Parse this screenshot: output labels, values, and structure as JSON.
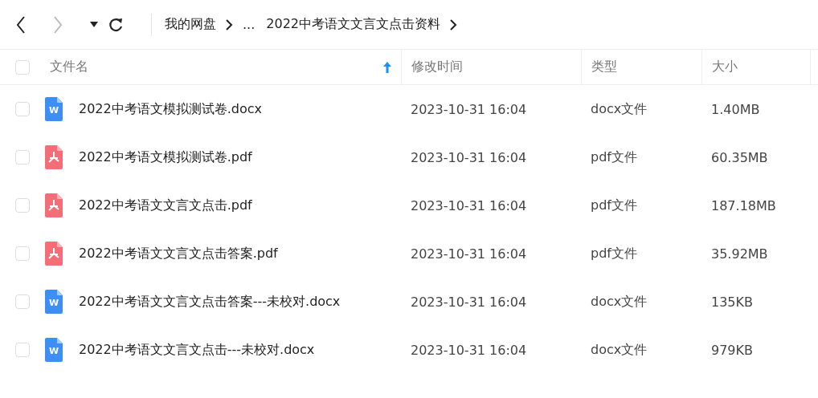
{
  "toolbar": {
    "back_disabled": false,
    "forward_disabled": true
  },
  "breadcrumb": [
    {
      "label": "我的网盘"
    },
    {
      "label": "..."
    },
    {
      "label": "2022中考语文文言文点击资料"
    }
  ],
  "table": {
    "select_all_checked": false,
    "columns": [
      {
        "label": "文件名",
        "sorted_ascending": true
      },
      {
        "label": "修改时间",
        "sorted_ascending": false
      },
      {
        "label": "类型",
        "sorted_ascending": false
      },
      {
        "label": "大小",
        "sorted_ascending": false
      }
    ],
    "rows": [
      {
        "checked": false,
        "kind": "docx",
        "badge": "W",
        "name": "2022中考语文模拟测试卷.docx",
        "modified": "2023-10-31 16:04",
        "type": "docx文件",
        "size": "1.40MB"
      },
      {
        "checked": false,
        "kind": "pdf",
        "name": "2022中考语文模拟测试卷.pdf",
        "modified": "2023-10-31 16:04",
        "type": "pdf文件",
        "size": "60.35MB"
      },
      {
        "checked": false,
        "kind": "pdf",
        "name": "2022中考语文文言文点击.pdf",
        "modified": "2023-10-31 16:04",
        "type": "pdf文件",
        "size": "187.18MB"
      },
      {
        "checked": false,
        "kind": "pdf",
        "name": "2022中考语文文言文点击答案.pdf",
        "modified": "2023-10-31 16:04",
        "type": "pdf文件",
        "size": "35.92MB"
      },
      {
        "checked": false,
        "kind": "docx",
        "badge": "W",
        "name": "2022中考语文文言文点击答案---未校对.docx",
        "modified": "2023-10-31 16:04",
        "type": "docx文件",
        "size": "135KB"
      },
      {
        "checked": false,
        "kind": "docx",
        "badge": "W",
        "name": "2022中考语文文言文点击---未校对.docx",
        "modified": "2023-10-31 16:04",
        "type": "docx文件",
        "size": "979KB"
      }
    ]
  }
}
